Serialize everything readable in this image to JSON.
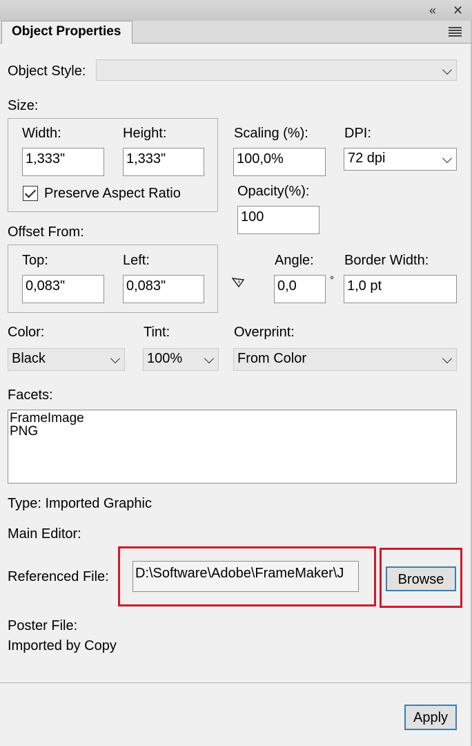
{
  "panel": {
    "tab_title": "Object Properties",
    "collapse_glyph": "«",
    "close_glyph": "✕",
    "menu_icon": "hamburger-menu-icon"
  },
  "object_style": {
    "label": "Object Style:",
    "value": ""
  },
  "size": {
    "label": "Size:",
    "width_label": "Width:",
    "width_value": "1,333\"",
    "height_label": "Height:",
    "height_value": "1,333\"",
    "preserve_label": "Preserve Aspect Ratio",
    "preserve_checked": true
  },
  "scaling": {
    "label": "Scaling (%):",
    "value": "100,0%"
  },
  "dpi": {
    "label": "DPI:",
    "value": "72 dpi"
  },
  "opacity": {
    "label": "Opacity(%):",
    "value": "100"
  },
  "offset": {
    "label": "Offset From:",
    "top_label": "Top:",
    "top_value": "0,083\"",
    "left_label": "Left:",
    "left_value": "0,083\""
  },
  "angle": {
    "label": "Angle:",
    "value": "0,0",
    "unit": "°"
  },
  "border_width": {
    "label": "Border Width:",
    "value": "1,0 pt"
  },
  "color": {
    "label": "Color:",
    "value": "Black"
  },
  "tint": {
    "label": "Tint:",
    "value": "100%"
  },
  "overprint": {
    "label": "Overprint:",
    "value": "From Color"
  },
  "facets": {
    "label": "Facets:",
    "items": [
      "FrameImage",
      "PNG"
    ]
  },
  "type_text": "Type: Imported Graphic",
  "main_editor_label": "Main Editor:",
  "referenced_file": {
    "label": "Referenced File:",
    "value": "D:\\Software\\Adobe\\FrameMaker\\J"
  },
  "browse_label": "Browse",
  "poster_file_label": "Poster File:",
  "imported_text": "Imported by Copy",
  "apply_label": "Apply",
  "colors": {
    "highlight": "#d0192b",
    "button_border": "#3c7fb1"
  }
}
